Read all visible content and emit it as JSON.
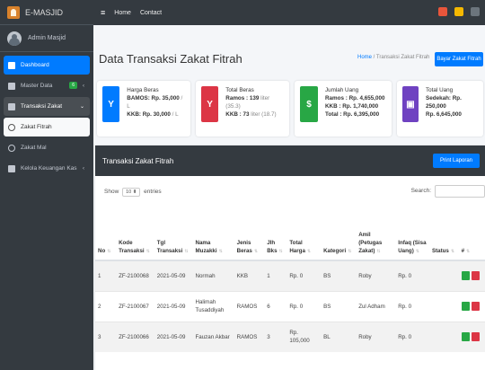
{
  "brand": {
    "title": "E-MASJID"
  },
  "topbar": {
    "home": "Home",
    "contact": "Contact"
  },
  "user": {
    "name": "Admin Masjid"
  },
  "sidebar": {
    "items": [
      {
        "label": "Dashboard"
      },
      {
        "label": "Master Data",
        "badge": "6"
      },
      {
        "label": "Transaksi Zakat"
      },
      {
        "label": "Zakat Fitrah"
      },
      {
        "label": "Zakat Mal"
      },
      {
        "label": "Kelola Keuangan Kas"
      }
    ]
  },
  "page": {
    "title": "Data Transaksi Zakat Fitrah",
    "breadcrumb_home": "Home",
    "breadcrumb_sep": " / ",
    "breadcrumb_current": "Transaksi Zakat Fitrah",
    "bayar_button": "Bayar Zakat Fitrah"
  },
  "info_boxes": [
    {
      "heading": "Harga Beras",
      "line1": "BAMOS: Rp. 35,000",
      "line1_unit": " / L",
      "line2": "KKB: Rp. 30,000",
      "line2_unit": " / L",
      "color": "#007bff"
    },
    {
      "heading": "Total Beras",
      "line1": "Ramos : 139",
      "line1_unit": " liter (35.3)",
      "line2": "KKB : 73",
      "line2_unit": " liter (18.7)",
      "color": "#dc3545"
    },
    {
      "heading": "Jumlah Uang",
      "line1": "Ramos : Rp. 4,655,000",
      "line2": "KKB : Rp. 1,740,000",
      "line3": "Total : Rp. 6,395,000",
      "color": "#28a745"
    },
    {
      "heading": "Total Uang",
      "line1": "Sedekah: Rp. 250,000",
      "line2": "Rp. 6,645,000",
      "color": "#6f42c1"
    }
  ],
  "card": {
    "title": "Transaksi Zakat Fitrah",
    "print_button": "Print Laporan",
    "show_label": "Show",
    "show_value": "10",
    "entries_label": "entries",
    "search_label": "Search:"
  },
  "table": {
    "headers": [
      "No",
      "Kode Transaksi",
      "Tgl Transaksi",
      "Nama Muzakki",
      "Jenis Beras",
      "Jlh Bks",
      "Total Harga",
      "Kategori",
      "Amil (Petugas Zakat)",
      "Infaq (Sisa Uang)",
      "Status",
      "#"
    ],
    "rows": [
      [
        "1",
        "ZF-2100068",
        "2021-05-09",
        "Normah",
        "KKB",
        "1",
        "Rp. 0",
        "BS",
        "Roby",
        "Rp. 0",
        ""
      ],
      [
        "2",
        "ZF-2100067",
        "2021-05-09",
        "Halimah Tusaddiyah",
        "RAMOS",
        "6",
        "Rp. 0",
        "BS",
        "Zul Adham",
        "Rp. 0",
        ""
      ],
      [
        "3",
        "ZF-2100066",
        "2021-05-09",
        "Fauzan Akbar",
        "RAMOS",
        "3",
        "Rp. 105,000",
        "BL",
        "Roby",
        "Rp. 0",
        ""
      ]
    ]
  },
  "colors": {
    "sidebar": "#343a40",
    "accent": "#007bff",
    "edit": "#28a745",
    "delete": "#dc3545"
  }
}
